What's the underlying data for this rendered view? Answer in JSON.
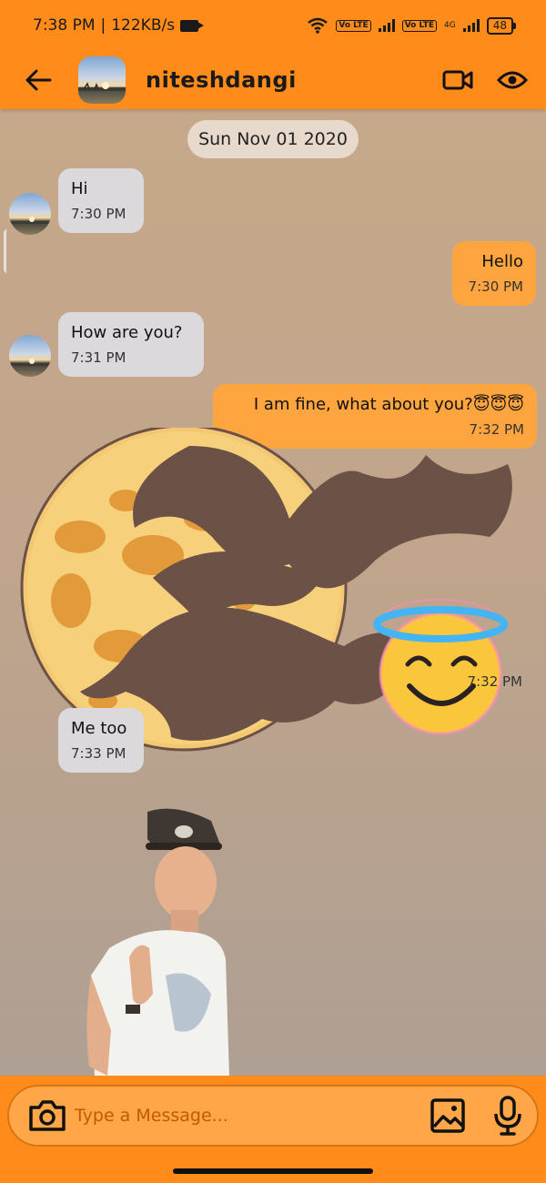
{
  "status_bar": {
    "time": "7:38 PM",
    "net_speed": "122KB/s",
    "sim1_tag": "Vo LTE",
    "sim2_tag": "Vo LTE",
    "network_type": "4G",
    "battery": "48"
  },
  "header": {
    "contact_name": "niteshdangi",
    "back_icon": "arrow-left-icon",
    "video_icon": "video-camera-icon",
    "view_icon": "eye-icon"
  },
  "chat": {
    "date_chip": "Sun Nov 01 2020",
    "messages": [
      {
        "direction": "received",
        "text": "Hi",
        "time": "7:30 PM"
      },
      {
        "direction": "sent",
        "text": "Hello",
        "time": "7:30 PM"
      },
      {
        "direction": "received",
        "text": "How are you?",
        "time": "7:31 PM"
      },
      {
        "direction": "sent",
        "text": "I am fine, what about you?😇😇😇",
        "time": "7:32 PM"
      },
      {
        "direction": "sent",
        "type": "sticker",
        "sticker": "halloween-moon-bats-with-smiling-halo-emoji",
        "time": "7:32 PM"
      },
      {
        "direction": "received",
        "text": "Me too",
        "time": "7:33 PM"
      },
      {
        "direction": "received",
        "type": "gif",
        "gif": "dancing-man-in-cap"
      }
    ]
  },
  "composer": {
    "placeholder": "Type a Message...",
    "camera_icon": "camera-icon",
    "gallery_icon": "image-icon",
    "mic_icon": "microphone-icon"
  },
  "colors": {
    "accent": "#ff8c1a",
    "sent_bubble": "#ffa53f",
    "received_bubble": "#dbd9dc",
    "chat_background": "#c1a58c"
  }
}
